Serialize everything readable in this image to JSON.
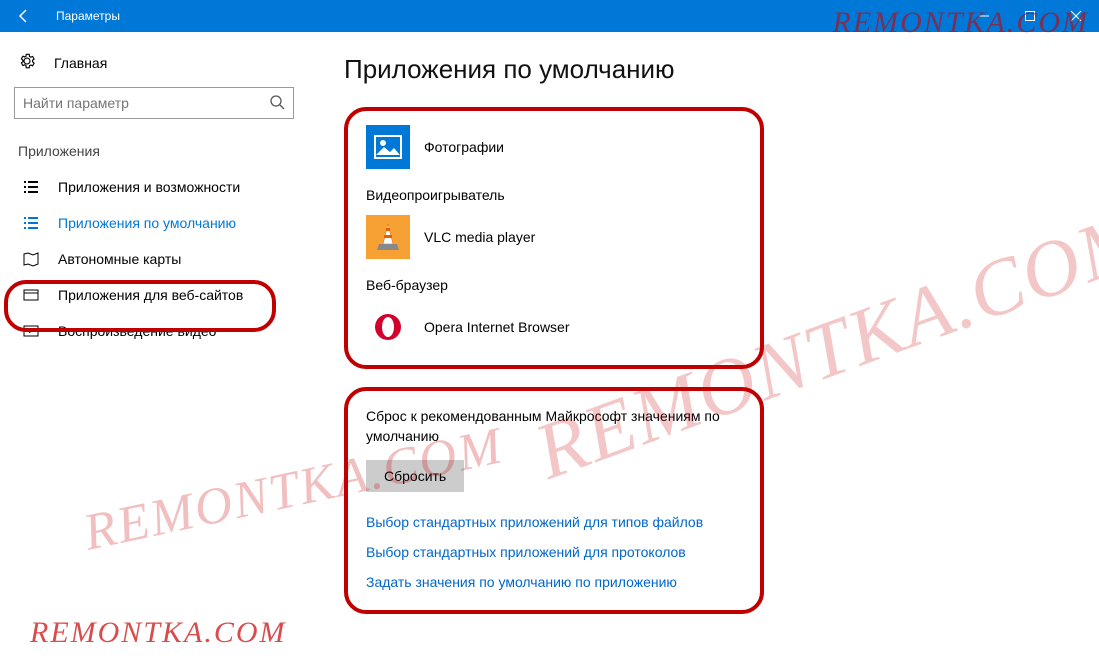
{
  "window": {
    "title": "Параметры"
  },
  "sidebar": {
    "home_label": "Главная",
    "search_placeholder": "Найти параметр",
    "section_label": "Приложения",
    "items": [
      {
        "label": "Приложения и возможности"
      },
      {
        "label": "Приложения по умолчанию"
      },
      {
        "label": "Автономные карты"
      },
      {
        "label": "Приложения для веб-сайтов"
      },
      {
        "label": "Воспроизведение видео"
      }
    ]
  },
  "main": {
    "title": "Приложения по умолчанию",
    "defaults": {
      "photo_app": "Фотографии",
      "video_label": "Видеопроигрыватель",
      "video_app": "VLC media player",
      "browser_label": "Веб-браузер",
      "browser_app": "Opera Internet Browser"
    },
    "reset": {
      "title": "Сброс к рекомендованным Майкрософт значениям по умолчанию",
      "button": "Сбросить",
      "link_filetypes": "Выбор стандартных приложений для типов файлов",
      "link_protocols": "Выбор стандартных приложений для протоколов",
      "link_byapp": "Задать значения по умолчанию по приложению"
    }
  },
  "watermark": "REMONTKA.COM"
}
